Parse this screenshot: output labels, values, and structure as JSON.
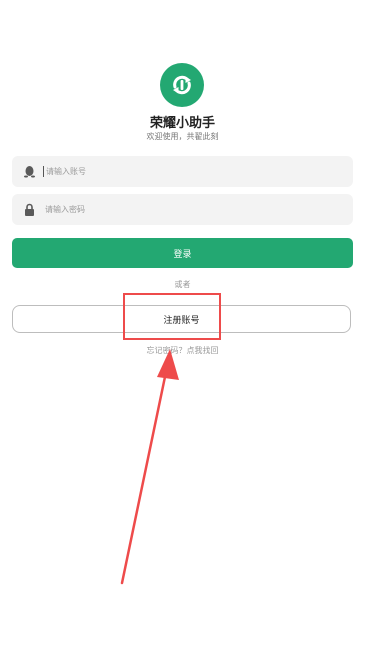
{
  "app": {
    "name": "荣耀小助手",
    "tagline": "欢迎使用，共翟此刻"
  },
  "account_field": {
    "placeholder": "请输入账号",
    "value": "",
    "icon": "qq-penguin-icon"
  },
  "password_field": {
    "placeholder": "请输入密码",
    "value": "",
    "icon": "lock-icon"
  },
  "login_button": {
    "label": "登录"
  },
  "or_separator": "或者",
  "register_button": {
    "label": "注册账号"
  },
  "forgot_link": "忘记密码？点我找回",
  "colors": {
    "brand_green": "#23a872",
    "annotation_red": "#ee4b4b"
  }
}
